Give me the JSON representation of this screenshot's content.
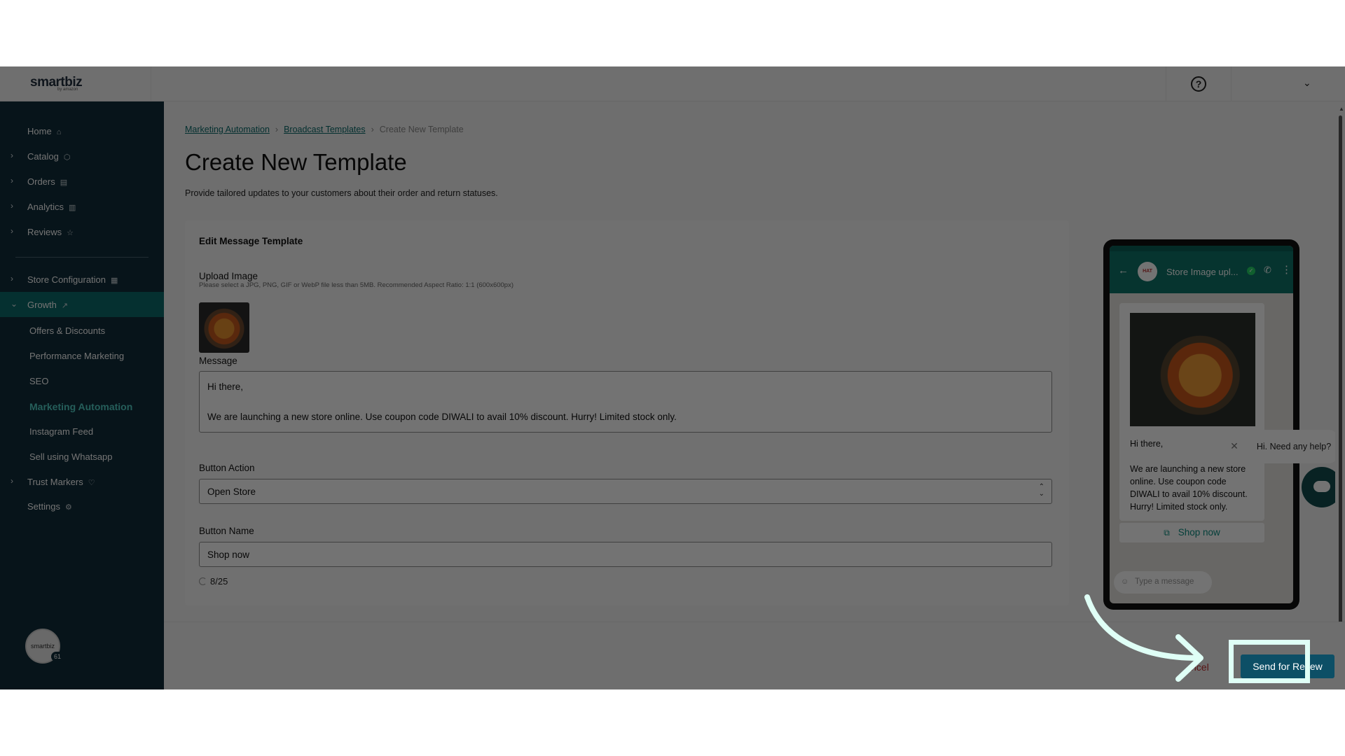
{
  "topbar": {
    "logo": "smartbiz",
    "logo_sub": "by amazon",
    "help_symbol": "?",
    "dropdown_symbol": "⌄"
  },
  "sidebar": {
    "items": [
      {
        "label": "Home",
        "icon": "home-icon"
      },
      {
        "label": "Catalog",
        "icon": "box-icon"
      },
      {
        "label": "Orders",
        "icon": "clipboard-icon"
      },
      {
        "label": "Analytics",
        "icon": "bar-chart-icon"
      },
      {
        "label": "Reviews",
        "icon": "star-icon"
      },
      {
        "label": "Store Configuration",
        "icon": "store-icon"
      },
      {
        "label": "Growth",
        "icon": "trend-up-icon"
      },
      {
        "label": "Trust Markers",
        "icon": "heart-shield-icon"
      },
      {
        "label": "Settings",
        "icon": "gear-icon"
      }
    ],
    "growth_sub": [
      "Offers & Discounts",
      "Performance Marketing",
      "SEO",
      "Marketing Automation",
      "Instagram Feed",
      "Sell using Whatsapp"
    ],
    "avatar_text": "smartbiz",
    "avatar_badge": "61"
  },
  "breadcrumb": {
    "items": [
      "Marketing Automation",
      "Broadcast Templates"
    ],
    "current": "Create New Template"
  },
  "page": {
    "title": "Create New Template",
    "description": "Provide tailored updates to your customers about their order and return statuses."
  },
  "form": {
    "card_title": "Edit Message Template",
    "upload_label": "Upload Image",
    "upload_hint": "Please select a JPG, PNG, GIF or WebP file less than 5MB. Recommended Aspect Ratio: 1:1 (600x600px)",
    "message_label": "Message",
    "message_line1": "Hi there,",
    "message_line2": "We are launching a new store online. Use coupon code DIWALI to avail 10% discount. Hurry! Limited stock only.",
    "button_action_label": "Button Action",
    "button_action_value": "Open Store",
    "button_name_label": "Button Name",
    "button_name_value": "Shop now",
    "char_count": "8/25"
  },
  "preview": {
    "contact_name": "Store Image upl...",
    "greeting": "Hi there,",
    "body": "We are launching a new store online. Use coupon code DIWALI to avail 10% discount. Hurry! Limited stock only.",
    "button": "Shop now",
    "input_placeholder": "Type a message"
  },
  "help_widget": {
    "text": "Hi. Need any help?"
  },
  "footer": {
    "cancel_label": "ncel",
    "send_label": "Send for Re   iew"
  },
  "colors": {
    "sidebar_bg": "#102d3a",
    "active_nav": "#0d6b6b",
    "link": "#0b6b6b",
    "primary_button": "#0d4f66",
    "whatsapp_header": "#0e7368",
    "highlight": "#dffff6"
  }
}
